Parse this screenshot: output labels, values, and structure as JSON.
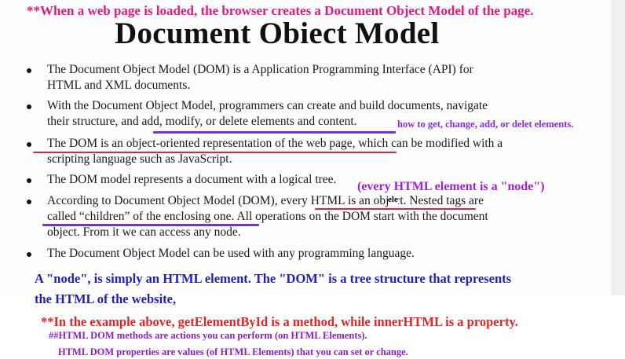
{
  "top_note": "**When a web page is loaded, the browser creates a Document Object Model of the page.",
  "title": "Document Obiect Model",
  "bullets": [
    {
      "line1": "The Document Object Model (DOM) is a Application Programming Interface (API) for",
      "line2": "HTML and XML documents."
    },
    {
      "line1": "With the Document Object Model, programmers can create and build documents, navigate",
      "line2": "their structure, and add, modify, or delete elements and content."
    },
    {
      "line1": "The DOM is an object-oriented representation of the web page, which can be modified with a",
      "line2": "scripting language such as JavaScript."
    },
    {
      "line1": "The DOM model represents a document with a logical tree."
    },
    {
      "line1": "According to Document Object Model (DOM), every HTML      is an object. Nested tags are",
      "line2": "called “children” of the enclosing one. All operations on the DOM start with the document",
      "line3": "object. From it we can access any node."
    },
    {
      "line1": "The Document Object Model can be used with any programming language."
    }
  ],
  "annotations": {
    "how_to": "how to get, change, add, or delet elements.",
    "node_note": "(every HTML element is a \"node\")",
    "ele_tag": "ele"
  },
  "blue_para": {
    "line1": "A \"node\",  is simply an HTML element. The \"DOM\" is a tree structure that represents",
    "line2": "the HTML of the website,"
  },
  "red_para": "**In the example above, getElementById is a method, while innerHTML is a property.",
  "methods_note": "##HTML DOM methods are actions you can perform (on HTML Elements).",
  "properties_note": "HTML DOM properties are values (of HTML Elements) that you can set or change."
}
